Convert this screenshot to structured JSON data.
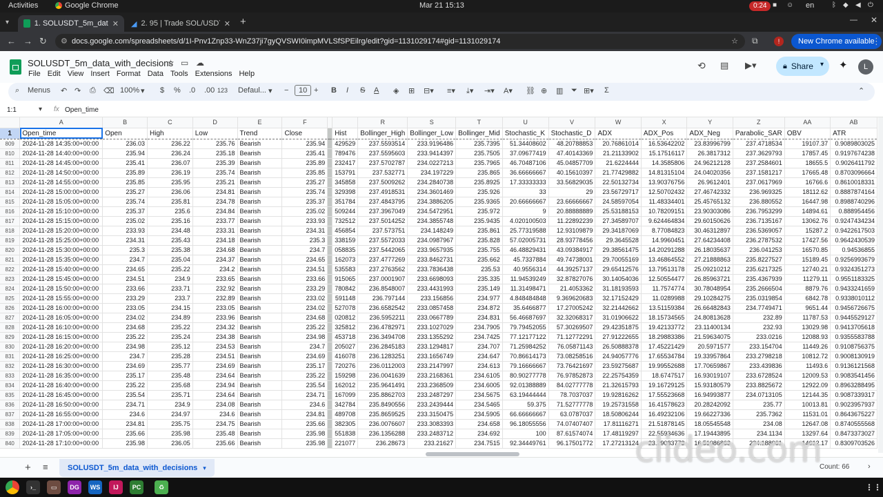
{
  "os": {
    "activities": "Activities",
    "app_name": "Google Chrome",
    "clock": "Mar 21  15:13",
    "recording_time": "0:24",
    "language": "en"
  },
  "browser": {
    "tabs": [
      {
        "label": "1. SOLUSDT_5m_data_w",
        "active": true
      },
      {
        "label": "2. 95 | Trade SOL/USDT",
        "active": false
      }
    ],
    "url": "docs.google.com/spreadsheets/d/1I-Pnv1Znp33-WnZ37ji7gyQVSWI0impMVLSfSPEilrg/edit?gid=1131029174#gid=1131029174",
    "new_chrome_label": "New Chrome available"
  },
  "sheets": {
    "doc_title": "SOLUSDT_5m_data_with_decisions",
    "menus": [
      "File",
      "Edit",
      "View",
      "Insert",
      "Format",
      "Data",
      "Tools",
      "Extensions",
      "Help"
    ],
    "share_label": "Share",
    "avatar_letter": "L",
    "toolbar": {
      "menus_label": "Menus",
      "zoom": "100%",
      "currency": "$",
      "percent": "%",
      "dec_less": ".0",
      "dec_more": ".00",
      "number_format": "123",
      "font": "Defaul...",
      "font_size": "10",
      "bold": "B",
      "italic": "I",
      "strike": "S",
      "text_color": "A"
    },
    "name_box": "1:1",
    "formula": "Open_time",
    "columns_left": [
      "A",
      "B",
      "C",
      "D",
      "E",
      "F"
    ],
    "columns_right": [
      "R",
      "S",
      "T",
      "U",
      "V",
      "W",
      "X",
      "Y",
      "Z",
      "AA",
      "AB"
    ],
    "header_row_number": "1",
    "headers_left": [
      "Open_time",
      "Open",
      "High",
      "Low",
      "Trend",
      "Close"
    ],
    "headers_right": [
      "Hist",
      "Bollinger_High",
      "Bollinger_Low",
      "Bollinger_Mid",
      "Stochastic_K",
      "Stochastic_D",
      "ADX",
      "ADX_Pos",
      "ADX_Neg",
      "Parabolic_SAR",
      "OBV",
      "ATR"
    ],
    "rows": [
      [
        "809",
        "2024-11-28 14:35:00+00:00",
        "236.03",
        "236.22",
        "235.76",
        "Bearish",
        "235.94",
        "429529",
        "237.5593514",
        "233.9196486",
        "235.7395",
        "51.34408602",
        "48.20788853",
        "20.76861014",
        "16.53642202",
        "23.83996799",
        "237.4718534",
        "19107.37",
        "0.9089803025"
      ],
      [
        "810",
        "2024-11-28 14:40:00+00:00",
        "235.94",
        "236.24",
        "235.18",
        "Bearish",
        "235.41",
        "789476",
        "237.5595603",
        "233.9414397",
        "235.7505",
        "37.09677419",
        "47.40143369",
        "21.21133902",
        "15.17516117",
        "26.3817312",
        "237.3629793",
        "17857.45",
        "0.9197674238"
      ],
      [
        "811",
        "2024-11-28 14:45:00+00:00",
        "235.41",
        "236.07",
        "235.39",
        "Bearish",
        "235.89",
        "232417",
        "237.5702787",
        "234.0227213",
        "235.7965",
        "46.70487106",
        "45.04857709",
        "21.6224444",
        "14.3585806",
        "24.96212128",
        "237.2584601",
        "18655.5",
        "0.9026411792"
      ],
      [
        "812",
        "2024-11-28 14:50:00+00:00",
        "235.89",
        "236.19",
        "235.74",
        "Bearish",
        "235.85",
        "153791",
        "237.532771",
        "234.197229",
        "235.865",
        "36.66666667",
        "40.15610397",
        "21.77429882",
        "14.81315104",
        "24.04020356",
        "237.1581217",
        "17665.48",
        "0.8703096664"
      ],
      [
        "813",
        "2024-11-28 14:55:00+00:00",
        "235.85",
        "235.95",
        "235.21",
        "Bearish",
        "235.27",
        "345858",
        "237.5009262",
        "234.2840738",
        "235.8925",
        "17.33333333",
        "33.56829035",
        "22.50132734",
        "13.90376756",
        "26.9612401",
        "237.0617969",
        "16766.6",
        "0.8610018331"
      ],
      [
        "814",
        "2024-11-28 15:00:00+00:00",
        "235.27",
        "236.06",
        "234.81",
        "Bearish",
        "235.74",
        "329398",
        "237.4918531",
        "234.3601469",
        "235.926",
        "33",
        "29",
        "23.56729717",
        "12.50702432",
        "27.46742332",
        "236.969325",
        "18112.62",
        "0.8887874164"
      ],
      [
        "815",
        "2024-11-28 15:05:00+00:00",
        "235.74",
        "235.81",
        "234.78",
        "Bearish",
        "235.37",
        "351784",
        "237.4843795",
        "234.3886205",
        "235.9365",
        "20.66666667",
        "23.66666667",
        "24.58597054",
        "11.48334401",
        "25.45765132",
        "236.880552",
        "16447.98",
        "0.8988740296"
      ],
      [
        "816",
        "2024-11-28 15:10:00+00:00",
        "235.37",
        "235.6",
        "234.84",
        "Bearish",
        "235.02",
        "509244",
        "237.3967049",
        "234.5472951",
        "235.972",
        "9",
        "20.88888889",
        "25.53188153",
        "10.78209151",
        "23.90303086",
        "236.7953299",
        "14894.61",
        "0.888954456"
      ],
      [
        "817",
        "2024-11-28 15:15:00+00:00",
        "235.02",
        "235.16",
        "233.77",
        "Bearish",
        "233.93",
        "732512",
        "237.5014252",
        "234.3855748",
        "235.9435",
        "4.020100503",
        "11.22892239",
        "27.34589707",
        "9.624464834",
        "29.60150626",
        "236.7135167",
        "13062.76",
        "0.9247434234"
      ],
      [
        "818",
        "2024-11-28 15:20:00+00:00",
        "233.93",
        "234.48",
        "233.31",
        "Bearish",
        "234.31",
        "456854",
        "237.573751",
        "234.148249",
        "235.861",
        "25.77319588",
        "12.93109879",
        "29.34187069",
        "8.77084823",
        "30.46312897",
        "236.5369057",
        "15287.2",
        "0.9422617503"
      ],
      [
        "819",
        "2024-11-28 15:25:00+00:00",
        "234.31",
        "235.43",
        "234.18",
        "Bearish",
        "235.3",
        "338159",
        "237.5572033",
        "234.0987967",
        "235.828",
        "57.02005731",
        "28.93778456",
        "29.3645528",
        "14.9960451",
        "27.64234408",
        "236.2787532",
        "17427.56",
        "0.9642430539"
      ],
      [
        "820",
        "2024-11-28 15:30:00+00:00",
        "235.3",
        "235.38",
        "234.68",
        "Bearish",
        "234.7",
        "058835",
        "237.5442065",
        "233.9657935",
        "235.755",
        "46.48829431",
        "43.09384917",
        "29.38561475",
        "14.20291288",
        "26.18035637",
        "236.041253",
        "16570.85",
        "0.94536855"
      ],
      [
        "821",
        "2024-11-28 15:35:00+00:00",
        "234.7",
        "235.04",
        "234.37",
        "Bearish",
        "234.65",
        "162073",
        "237.4777269",
        "233.8462731",
        "235.662",
        "45.7337884",
        "49.74738001",
        "29.70055169",
        "13.46864552",
        "27.21888863",
        "235.8227527",
        "15189.45",
        "0.9256993679"
      ],
      [
        "822",
        "2024-11-28 15:40:00+00:00",
        "234.65",
        "235.22",
        "234.2",
        "Bearish",
        "234.51",
        "535583",
        "237.2763562",
        "233.7836438",
        "235.53",
        "40.9556314",
        "44.39257137",
        "29.65412576",
        "13.79513178",
        "25.09210212",
        "235.6217325",
        "12740.21",
        "0.9324351273"
      ],
      [
        "823",
        "2024-11-28 15:45:00+00:00",
        "234.51",
        "234.9",
        "233.65",
        "Bearish",
        "233.66",
        "915065",
        "237.0001907",
        "233.6698093",
        "235.335",
        "11.94539249",
        "32.87827076",
        "30.14054036",
        "12.50554477",
        "26.85963721",
        "235.4367939",
        "11279.11",
        "0.9551183325"
      ],
      [
        "824",
        "2024-11-28 15:50:00+00:00",
        "233.66",
        "233.71",
        "232.92",
        "Bearish",
        "233.29",
        "780842",
        "236.8548007",
        "233.4431993",
        "235.149",
        "11.31498471",
        "21.4053362",
        "31.18193593",
        "11.7574774",
        "30.78048954",
        "235.2666504",
        "8879.76",
        "0.9433241659"
      ],
      [
        "825",
        "2024-11-28 15:55:00+00:00",
        "233.29",
        "233.7",
        "232.89",
        "Bearish",
        "233.02",
        "591148",
        "236.797144",
        "233.156856",
        "234.977",
        "4.848484848",
        "9.369620683",
        "32.17152429",
        "11.0289988",
        "29.10284275",
        "235.0319854",
        "6842.78",
        "0.9338010112"
      ],
      [
        "826",
        "2024-11-28 16:00:00+00:00",
        "233.05",
        "234.15",
        "233.05",
        "Bearish",
        "234.02",
        "527078",
        "236.6582542",
        "233.0857458",
        "234.872",
        "35.6466877",
        "17.27005242",
        "32.21442662",
        "13.51159384",
        "26.66482843",
        "234.7749471",
        "9651.44",
        "0.9456726675"
      ],
      [
        "827",
        "2024-11-28 16:05:00+00:00",
        "234.02",
        "234.89",
        "233.96",
        "Bearish",
        "234.68",
        "020812",
        "236.5952211",
        "233.0667789",
        "234.831",
        "56.46687697",
        "32.32068317",
        "31.01906622",
        "18.15734565",
        "24.80813628",
        "232.89",
        "11787.53",
        "0.9445529127"
      ],
      [
        "828",
        "2024-11-28 16:10:00+00:00",
        "234.68",
        "235.22",
        "234.32",
        "Bearish",
        "235.22",
        "325812",
        "236.4782971",
        "233.1027029",
        "234.7905",
        "79.79452055",
        "57.30269507",
        "29.42351875",
        "19.42133772",
        "23.11400134",
        "232.93",
        "13029.98",
        "0.9413705618"
      ],
      [
        "829",
        "2024-11-28 16:15:00+00:00",
        "235.22",
        "235.24",
        "234.38",
        "Bearish",
        "234.98",
        "453718",
        "236.3494708",
        "233.1355292",
        "234.7425",
        "77.12177122",
        "71.12772291",
        "27.91222655",
        "18.29883386",
        "21.59634075",
        "233.0216",
        "12088.93",
        "0.9355583788"
      ],
      [
        "830",
        "2024-11-28 16:20:00+00:00",
        "234.98",
        "235.12",
        "234.53",
        "Bearish",
        "234.7",
        "205027",
        "236.2845183",
        "233.1294817",
        "234.707",
        "71.25984252",
        "76.05871143",
        "26.50888378",
        "17.45221429",
        "20.5971577",
        "233.154704",
        "11449.26",
        "0.9108756375"
      ],
      [
        "831",
        "2024-11-28 16:25:00+00:00",
        "234.7",
        "235.28",
        "234.51",
        "Bearish",
        "234.69",
        "416078",
        "236.1283251",
        "233.1656749",
        "234.647",
        "70.86614173",
        "73.08258516",
        "24.94057776",
        "17.65534784",
        "19.33957864",
        "233.2798218",
        "10812.72",
        "0.9008130919"
      ],
      [
        "832",
        "2024-11-28 16:30:00+00:00",
        "234.69",
        "235.77",
        "234.69",
        "Bearish",
        "235.17",
        "720276",
        "236.0112003",
        "233.2147997",
        "234.613",
        "79.16666667",
        "73.76421697",
        "23.59275687",
        "19.99552688",
        "17.70659867",
        "233.439836",
        "11493.6",
        "0.9136121568"
      ],
      [
        "833",
        "2024-11-28 16:35:00+00:00",
        "235.17",
        "235.48",
        "234.64",
        "Bearish",
        "235.22",
        "159298",
        "236.0041639",
        "233.2168361",
        "234.6105",
        "80.90277778",
        "76.97852873",
        "22.25754359",
        "18.6747517",
        "16.93019107",
        "233.6728524",
        "12009.53",
        "0.9083541456"
      ],
      [
        "834",
        "2024-11-28 16:40:00+00:00",
        "235.22",
        "235.68",
        "234.94",
        "Bearish",
        "235.54",
        "162012",
        "235.9641491",
        "233.2368509",
        "234.6005",
        "92.01388889",
        "84.02777778",
        "21.32615793",
        "19.16729125",
        "15.93180579",
        "233.8825672",
        "12922.09",
        "0.8963288495"
      ],
      [
        "835",
        "2024-11-28 16:45:00+00:00",
        "235.54",
        "235.71",
        "234.64",
        "Bearish",
        "234.71",
        "167099",
        "235.8862703",
        "233.2487297",
        "234.5675",
        "63.19444444",
        "78.7037037",
        "19.92816262",
        "17.55523668",
        "16.94993877",
        "234.0713105",
        "12144.35",
        "0.9087339317"
      ],
      [
        "836",
        "2024-11-28 16:50:00+00:00",
        "234.71",
        "234.9",
        "234.08",
        "Bearish",
        "234.6",
        "342784",
        "235.8490556",
        "233.2439444",
        "234.5465",
        "59.375",
        "71.52777778",
        "19.25731558",
        "16.41578623",
        "20.28242092",
        "235.77",
        "10013.81",
        "0.9023957937"
      ],
      [
        "837",
        "2024-11-28 16:55:00+00:00",
        "234.6",
        "234.97",
        "234.6",
        "Bearish",
        "234.81",
        "489708",
        "235.8659525",
        "233.3150475",
        "234.5905",
        "66.66666667",
        "63.0787037",
        "18.50806244",
        "16.49232106",
        "19.66227336",
        "235.7362",
        "11531.01",
        "0.8643675227"
      ],
      [
        "838",
        "2024-11-28 17:00:00+00:00",
        "234.81",
        "235.75",
        "234.75",
        "Bearish",
        "235.66",
        "382305",
        "236.0076607",
        "233.3083393",
        "234.658",
        "96.18055556",
        "74.07407407",
        "17.81116271",
        "21.51878145",
        "18.05545548",
        "234.08",
        "12647.08",
        "0.8740555568"
      ],
      [
        "839",
        "2024-11-28 17:05:00+00:00",
        "235.66",
        "235.98",
        "235.48",
        "Bearish",
        "235.98",
        "551838",
        "236.1356288",
        "233.2483712",
        "234.692",
        "100",
        "87.61574074",
        "17.48119297",
        "22.55934636",
        "17.19443895",
        "234.1134",
        "13297.64",
        "0.8473373027"
      ],
      [
        "840",
        "2024-11-28 17:10:00+00:00",
        "235.98",
        "236.05",
        "235.66",
        "Bearish",
        "235.98",
        "221077",
        "236.28673",
        "233.21627",
        "234.7515",
        "92.34449761",
        "96.17501772",
        "17.27213124",
        "23.29083773",
        "16.51086863",
        "234.188061",
        "14612.17",
        "0.8309703526"
      ]
    ],
    "sheet_tab_label": "SOLUSDT_5m_data_with_decisions",
    "count_label": "Count: 66"
  },
  "watermark": "clideo.com",
  "colors": {
    "accent": "#1a73e8",
    "share_bg": "#c2e7ff",
    "new_chrome_bg": "#0b57d0",
    "sheets_green": "#0f9d58"
  }
}
